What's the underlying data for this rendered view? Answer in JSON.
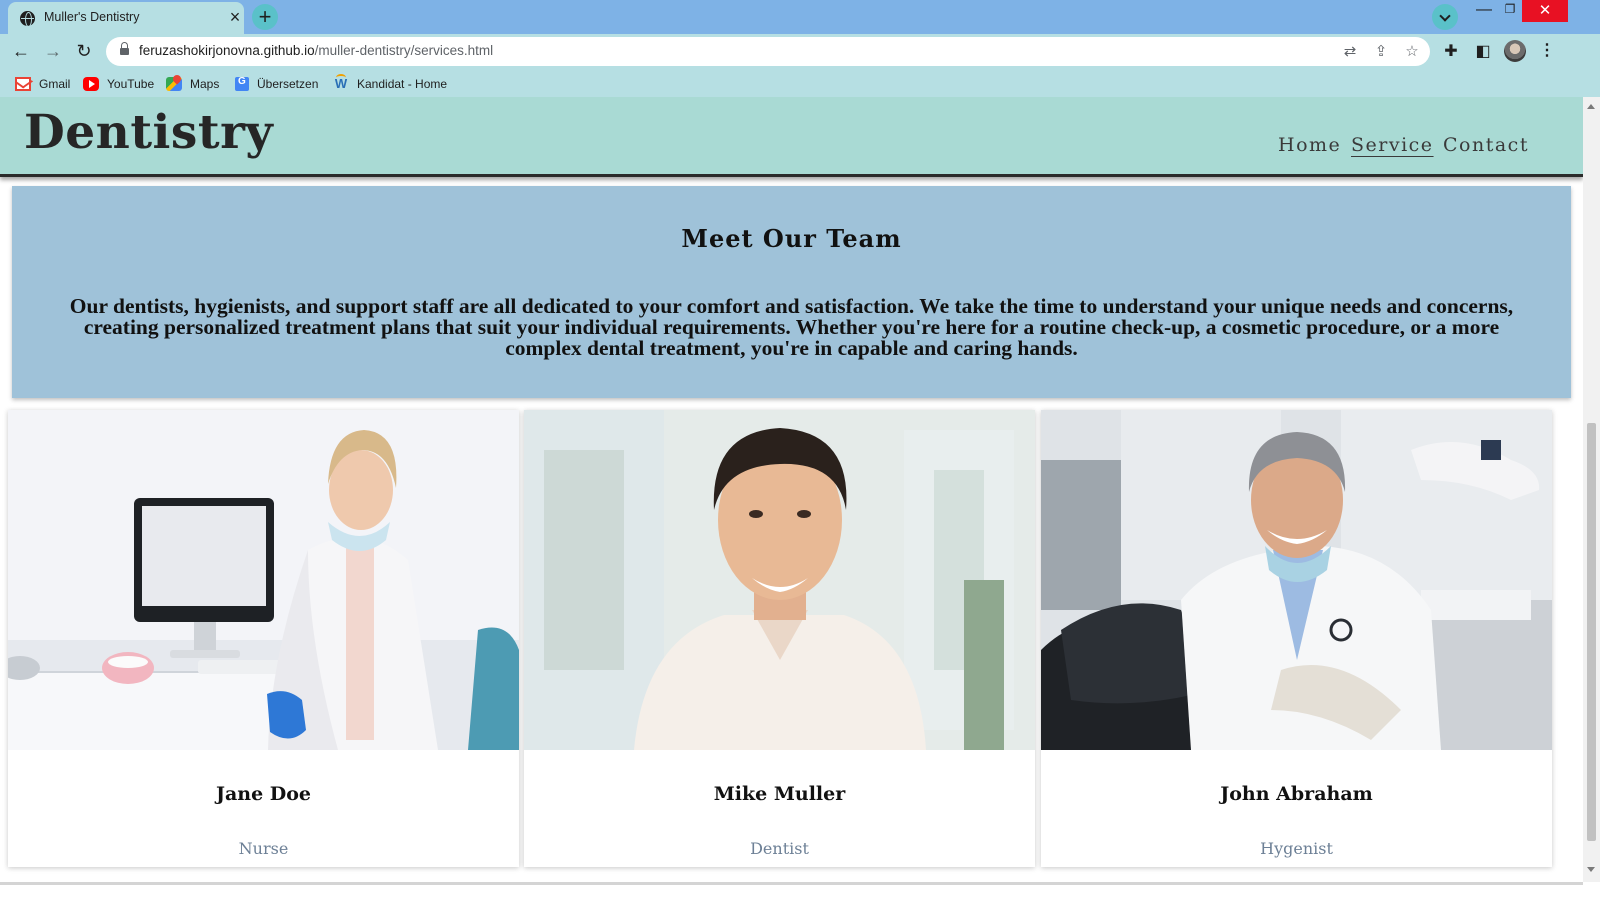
{
  "browser": {
    "tab_title": "Muller's Dentistry",
    "url_host": "feruzashokirjonovna.github.io",
    "url_path": "/muller-dentistry/services.html",
    "bookmarks": [
      {
        "label": "Gmail",
        "icon": "gmail-icon"
      },
      {
        "label": "YouTube",
        "icon": "youtube-icon"
      },
      {
        "label": "Maps",
        "icon": "maps-icon"
      },
      {
        "label": "Übersetzen",
        "icon": "translate-icon"
      },
      {
        "label": "Kandidat - Home",
        "icon": "kandidat-icon"
      }
    ]
  },
  "site": {
    "logo": "Dentistry",
    "nav": [
      {
        "label": "Home",
        "active": false
      },
      {
        "label": "Service",
        "active": true
      },
      {
        "label": "Contact",
        "active": false
      }
    ]
  },
  "team": {
    "title": "Meet Our Team",
    "text": "Our dentists, hygienists, and support staff are all dedicated to your comfort and satisfaction. We take the time to understand your unique needs and concerns, creating personalized treatment plans that suit your individual requirements. Whether you're here for a routine check-up, a cosmetic procedure, or a more complex dental treatment, you're in capable and caring hands.",
    "members": [
      {
        "name": "Jane Doe",
        "role": "Nurse"
      },
      {
        "name": "Mike Muller",
        "role": "Dentist"
      },
      {
        "name": "John Abraham",
        "role": "Hygenist"
      }
    ]
  },
  "colors": {
    "titlebar": "#7eb2e6",
    "toolbar": "#b6dfe3",
    "header": "#a9dad4",
    "team_panel": "#9fc2d9",
    "role_text": "#6d8096"
  }
}
